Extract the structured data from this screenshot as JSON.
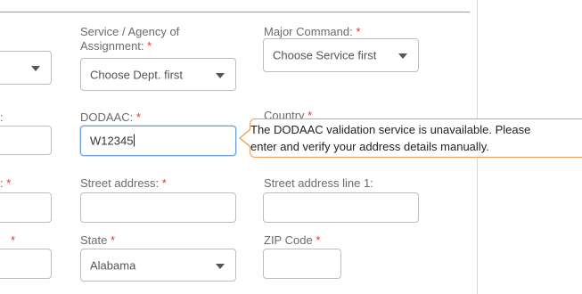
{
  "fields": {
    "service_agency": {
      "label": "Service / Agency of Assignment:",
      "required_mark": "*",
      "value": "Choose Dept. first"
    },
    "major_command": {
      "label": "Major Command:",
      "required_mark": "*",
      "value": "Choose Service first"
    },
    "dodaac": {
      "label": "DODAAC:",
      "required_mark": "*",
      "value": "W12345"
    },
    "country": {
      "label": "Country",
      "required_mark": "*"
    },
    "street_address": {
      "label": "Street address:",
      "required_mark": "*",
      "value": ""
    },
    "street_address_line1": {
      "label": "Street address line 1:",
      "value": ""
    },
    "state": {
      "label": "State",
      "required_mark": "*",
      "value": "Alabama"
    },
    "zip": {
      "label": "ZIP Code",
      "required_mark": "*",
      "value": ""
    }
  },
  "left_partial": {
    "row2_label": ":",
    "row3_label": ":",
    "row3_required": "*",
    "row4_required": "*"
  },
  "tooltip": {
    "line1": "The DODAAC validation service is unavailable. Please",
    "line2": "enter and verify your address details manually."
  },
  "colors": {
    "required": "#e3342f",
    "tooltip_border": "#e6a15a",
    "focus_border": "#6aa0d8"
  }
}
